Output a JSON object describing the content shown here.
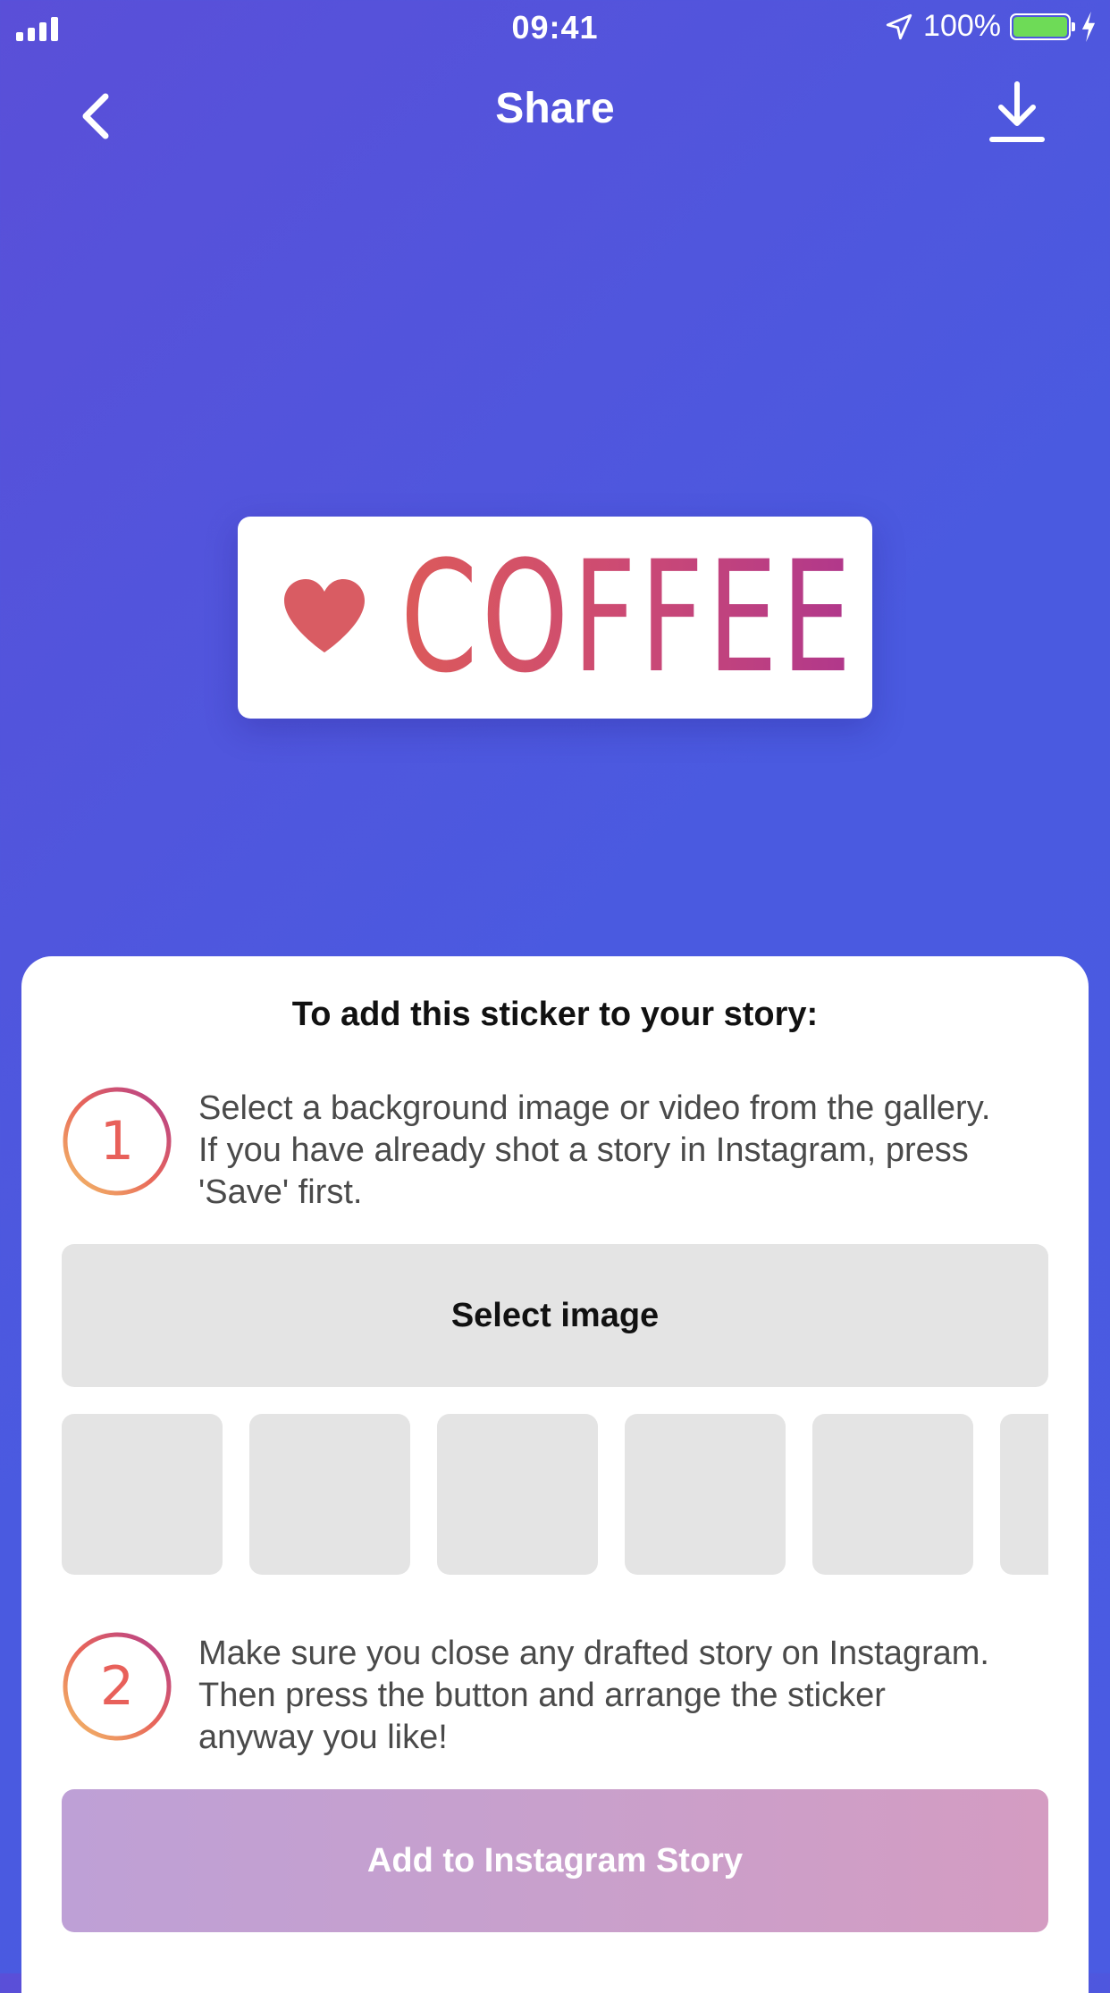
{
  "status_bar": {
    "time": "09:41",
    "battery_text": "100%",
    "icons": [
      "signal-icon",
      "location-arrow-icon",
      "battery-icon",
      "charging-bolt-icon"
    ]
  },
  "nav": {
    "title": "Share",
    "back_icon": "chevron-left-icon",
    "download_icon": "download-icon"
  },
  "sticker": {
    "icon": "heart-icon",
    "text": "COFFEE"
  },
  "panel": {
    "title": "To add this sticker to your story:",
    "step1": {
      "number": "1",
      "text": "Select a background image or video from the gallery. If you have already shot a story in Instagram, press  'Save' first."
    },
    "select_button": "Select image",
    "thumbnail_count": 6,
    "step2": {
      "number": "2",
      "text": "Make sure you close any drafted story on Instagram. Then press the button and arrange the sticker anyway you like!"
    },
    "add_button": "Add to Instagram Story"
  },
  "colors": {
    "background_start": "#5a4fd8",
    "background_end": "#4a5be2",
    "accent_orange": "#e8795a",
    "accent_pink": "#b0378c",
    "button_gray": "#e4e4e4",
    "battery_green": "#6edb57"
  }
}
